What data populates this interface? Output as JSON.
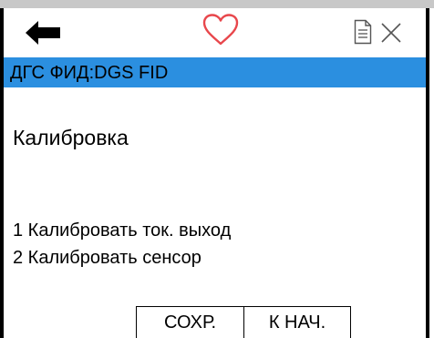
{
  "toolbar": {
    "back_icon": "back-arrow-icon",
    "favorite_icon": "heart-icon",
    "document_icon": "document-icon",
    "close_icon": "close-icon"
  },
  "header": {
    "title": "ДГС ФИД:DGS FID",
    "background_color": "#2b8fe0"
  },
  "menu": {
    "heading": "Калибровка",
    "items": [
      {
        "label": "1 Калибровать ток. выход"
      },
      {
        "label": "2 Калибровать сенсор"
      }
    ]
  },
  "buttons": {
    "save_label": "СОХР.",
    "home_label": "К НАЧ."
  }
}
